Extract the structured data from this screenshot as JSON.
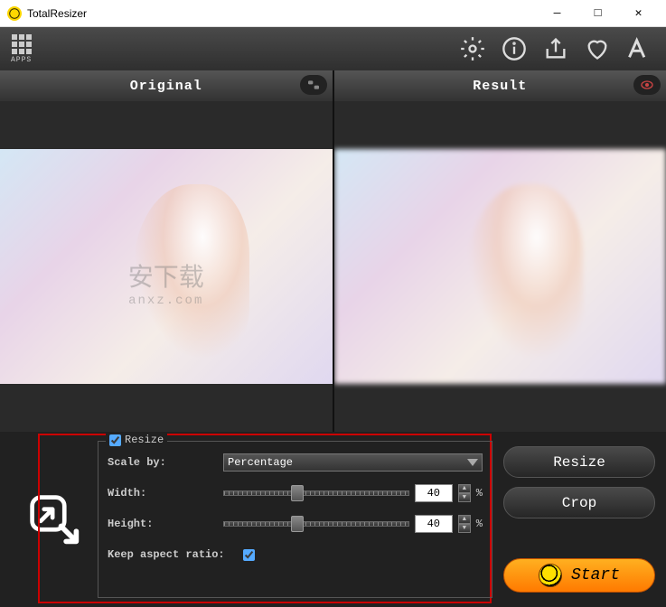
{
  "window": {
    "title": "TotalResizer",
    "min": "—",
    "max": "□",
    "close": "✕"
  },
  "toolbar": {
    "apps_label": "APPS"
  },
  "panels": {
    "original_label": "Original",
    "result_label": "Result"
  },
  "watermark": {
    "main": "安下载",
    "sub": "anxz.com"
  },
  "options": {
    "group_label": "Resize",
    "group_checked": true,
    "scale_by_label": "Scale by:",
    "scale_by_value": "Percentage",
    "width_label": "Width:",
    "width_value": "40",
    "width_unit": "%",
    "height_label": "Height:",
    "height_value": "40",
    "height_unit": "%",
    "keep_ar_label": "Keep aspect ratio:",
    "keep_ar_checked": true
  },
  "buttons": {
    "resize": "Resize",
    "crop": "Crop",
    "start": "Start"
  }
}
